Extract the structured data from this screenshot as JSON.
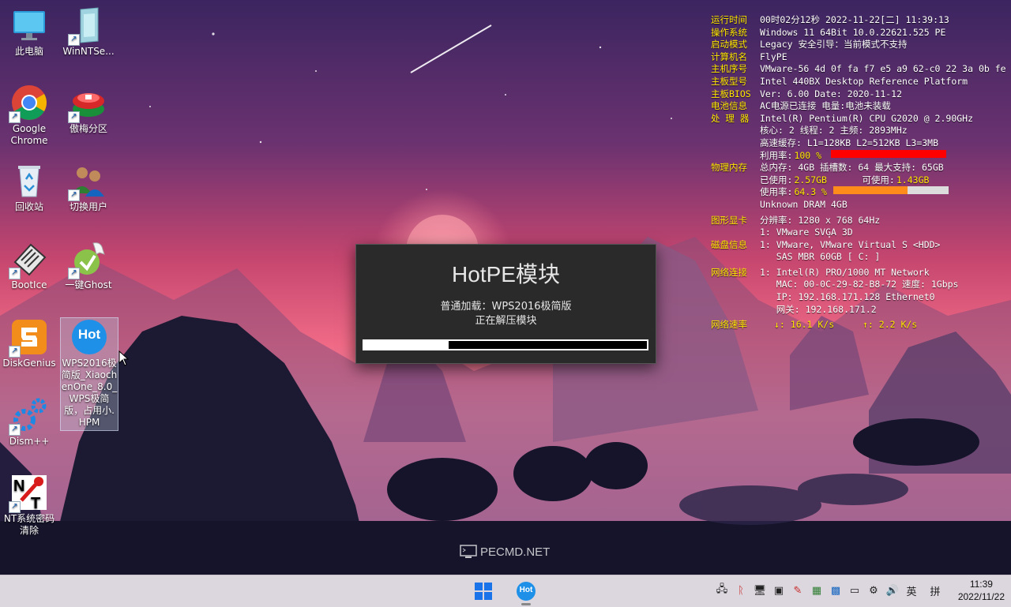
{
  "desktop": {
    "icons": [
      {
        "label": "此电脑"
      },
      {
        "label": "WinNTSe..."
      },
      {
        "label": "Google Chrome"
      },
      {
        "label": "傲梅分区"
      },
      {
        "label": "回收站"
      },
      {
        "label": "切换用户"
      },
      {
        "label": "BootIce"
      },
      {
        "label": "一键Ghost"
      },
      {
        "label": "DiskGenius"
      },
      {
        "label": "WPS2016极简版_XiaochenOne_8.0_WPS极简版，占用小.HPM"
      },
      {
        "label": "Dism++"
      },
      {
        "label": "NT系统密码清除"
      }
    ],
    "hot_badge": "Hot"
  },
  "sysinfo": {
    "runtime_label": "运行时间",
    "runtime": "00时02分12秒 2022-11-22[二] 11:39:13",
    "os_label": "操作系统",
    "os": "Windows 11 64Bit 10.0.22621.525 PE",
    "boot_label": "启动模式",
    "boot": "Legacy     安全引导：当前模式不支持",
    "pc_label": "计算机名",
    "pc": "FlyPE",
    "serial_label": "主机序号",
    "serial": "VMware-56 4d 0f fa f7 e5 a9 62-c0 22 3a 0b fe",
    "board_label": "主板型号",
    "board": "Intel 440BX Desktop Reference Platform",
    "bios_label": "主板BIOS",
    "bios": "Ver: 6.00  Date: 2020-11-12",
    "battery_label": "电池信息",
    "battery": "AC电源已连接  电量:电池未装载",
    "cpu_label": "处 理 器",
    "cpu": "Intel(R) Pentium(R) CPU G2020 @ 2.90GHz",
    "cpu_cores": "核心: 2  线程: 2       主频: 2893MHz",
    "cpu_cache": "高速缓存: L1=128KB L2=512KB L3=3MB",
    "cpu_usage_label": "利用率:",
    "cpu_usage": "100 %",
    "cpu_usage_fraction": 1.0,
    "mem_label": "物理内存",
    "mem_total": "总内存: 4GB 插槽数: 64 最大支持: 65GB",
    "mem_used_label": "已使用:",
    "mem_used": "2.57GB",
    "mem_avail_label": "可使用:",
    "mem_avail": "1.43GB",
    "mem_usage_label": "使用率:",
    "mem_usage": "64.3 %",
    "mem_usage_fraction": 0.643,
    "mem_dram": "Unknown DRAM 4GB",
    "gpu_label": "图形显卡",
    "gpu_res": "分辨率: 1280 x 768 64Hz",
    "gpu_name": "1: VMware SVGA 3D",
    "disk_label": "磁盘信息",
    "disk_1": "1: VMware, VMware Virtual S <HDD>",
    "disk_2": "   SAS MBR 60GB [ C: ]",
    "net_label": "网络连接",
    "net_1": "1: Intel(R) PRO/1000 MT Network",
    "net_mac": "   MAC: 00-0C-29-82-B8-72 速度: 1Gbps",
    "net_ip": "   IP: 192.168.171.128 Ethernet0",
    "net_gw": "   网关: 192.168.171.2",
    "speed_label": "网络速率",
    "speed_down": "↓: 16.1 K/s",
    "speed_up": "↑: 2.2 K/s",
    "cpu_bar_color": "#ff0000",
    "mem_bar_color": "#ff8c1a"
  },
  "dialog": {
    "title": "HotPE模块",
    "line1": "普通加载：WPS2016极简版",
    "line2": "正在解压模块",
    "progress_fraction": 0.3
  },
  "watermark": {
    "text": "PECMD.NET"
  },
  "taskbar": {
    "hot_label": "Hot",
    "ime": "英",
    "ime2": "拼",
    "time": "11:39",
    "date": "2022/11/22"
  }
}
